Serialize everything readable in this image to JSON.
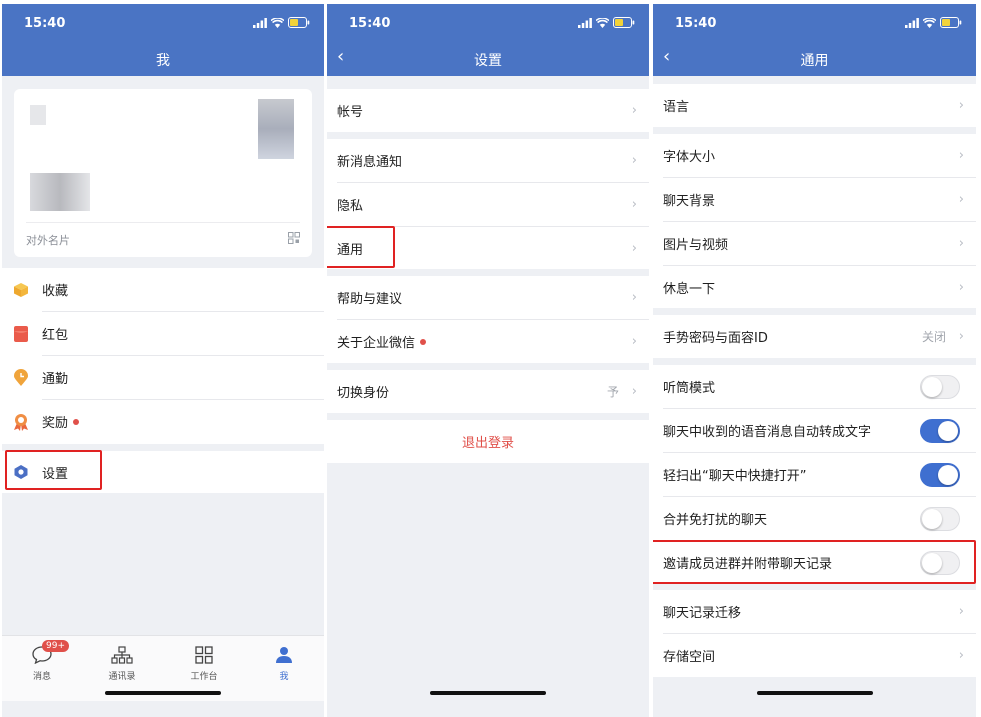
{
  "status_time": "15:40",
  "screen1": {
    "title": "我",
    "card_label": "对外名片",
    "menu": [
      {
        "label": "收藏",
        "icon": "box-icon"
      },
      {
        "label": "红包",
        "icon": "red-envelope-icon"
      },
      {
        "label": "通勤",
        "icon": "clock-pin-icon"
      },
      {
        "label": "奖励",
        "icon": "medal-icon"
      }
    ],
    "settings_label": "设置",
    "tabs": [
      {
        "label": "消息",
        "badge": "99+"
      },
      {
        "label": "通讯录"
      },
      {
        "label": "工作台"
      },
      {
        "label": "我"
      }
    ]
  },
  "screen2": {
    "title": "设置",
    "items": {
      "account": "帐号",
      "notify": "新消息通知",
      "privacy": "隐私",
      "general": "通用",
      "help": "帮助与建议",
      "about": "关于企业微信",
      "switch_identity": "切换身份",
      "switch_value": "予",
      "logout": "退出登录"
    }
  },
  "screen3": {
    "title": "通用",
    "items": {
      "language": "语言",
      "font_size": "字体大小",
      "chat_bg": "聊天背景",
      "media": "图片与视频",
      "rest": "休息一下",
      "gesture": "手势密码与面容ID",
      "gesture_value": "关闭",
      "earpiece": "听筒模式",
      "voice_to_text": "聊天中收到的语音消息自动转成文字",
      "swipe_open": "轻扫出“聊天中快捷打开”",
      "merge_dnd": "合并免打扰的聊天",
      "invite_history": "邀请成员进群并附带聊天记录",
      "migrate": "聊天记录迁移",
      "storage": "存储空间"
    },
    "toggles": {
      "earpiece": false,
      "voice_to_text": true,
      "swipe_open": true,
      "merge_dnd": false,
      "invite_history": false
    }
  },
  "colors": {
    "header": "#4a74c4",
    "highlight": "#e02222",
    "toggle_on": "#3f6fd0",
    "logout_text": "#e0504a",
    "active_tab": "#3f6fd0"
  }
}
